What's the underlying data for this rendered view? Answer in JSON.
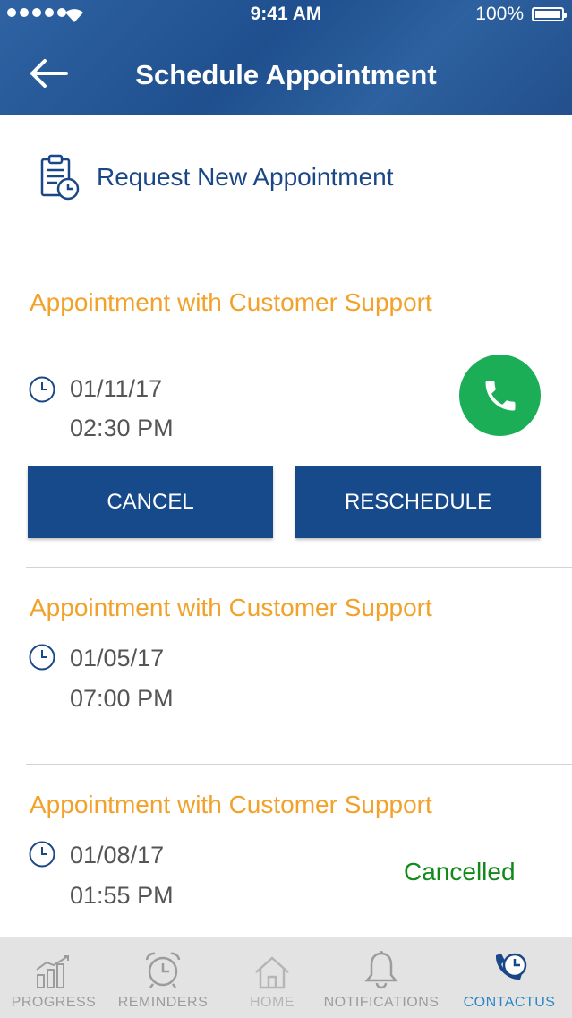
{
  "status_bar": {
    "time": "9:41 AM",
    "battery": "100%"
  },
  "header": {
    "title": "Schedule Appointment"
  },
  "request": {
    "label": "Request New Appointment"
  },
  "appointments": [
    {
      "title": "Appointment with Customer Support",
      "date": "01/11/17",
      "time": "02:30 PM",
      "cancel_label": "CANCEL",
      "reschedule_label": "RESCHEDULE"
    },
    {
      "title": "Appointment with Customer Support",
      "date": "01/05/17",
      "time": "07:00 PM"
    },
    {
      "title": "Appointment with Customer Support",
      "date": "01/08/17",
      "time": "01:55 PM",
      "status": "Cancelled"
    }
  ],
  "tabs": [
    {
      "label": "PROGRESS",
      "icon": "chart-icon"
    },
    {
      "label": "REMINDERS",
      "icon": "alarm-clock-icon"
    },
    {
      "label": "HOME",
      "icon": "home-icon"
    },
    {
      "label": "NOTIFICATIONS",
      "icon": "bell-icon"
    },
    {
      "label": "CONTACTUS",
      "icon": "phone-clock-icon",
      "active": true
    }
  ],
  "colors": {
    "header": "#1f4f8e",
    "accent_orange": "#f2a22a",
    "button": "#174a8b",
    "call_green": "#1bae57",
    "cancelled_green": "#128a1a",
    "tab_active": "#2a86c6"
  }
}
